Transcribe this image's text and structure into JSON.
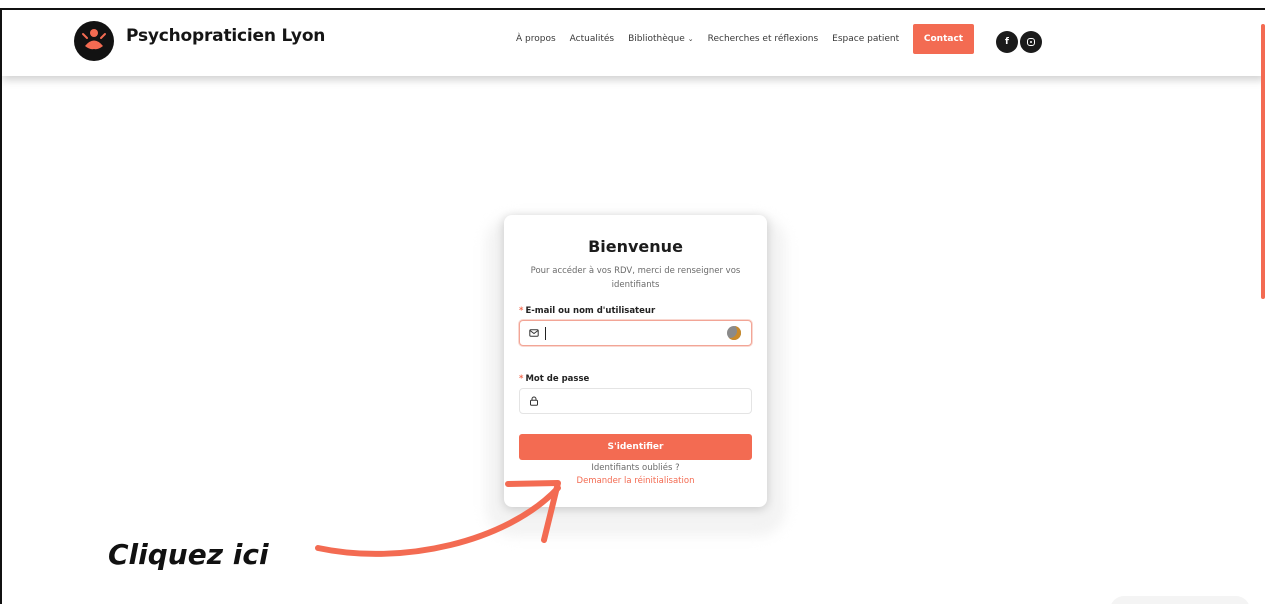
{
  "brand": {
    "name": "Psychopraticien Lyon",
    "logo_icon": "meditation-figure-icon"
  },
  "nav": {
    "items": [
      "À propos",
      "Actualités",
      "Bibliothèque",
      "Recherches et réflexions",
      "Espace patient"
    ],
    "contact_label": "Contact",
    "social": [
      {
        "icon": "facebook-icon",
        "glyph": "f"
      },
      {
        "icon": "instagram-icon"
      }
    ]
  },
  "login": {
    "title": "Bienvenue",
    "subtitle": "Pour accéder à vos RDV, merci de renseigner vos identifiants",
    "email_label": "E-mail ou nom d'utilisateur",
    "email_value": "",
    "password_label": "Mot de passe",
    "password_value": "",
    "required_mark": "*",
    "submit_label": "S'identifier",
    "forgot_text": "Identifiants oubliés ?",
    "reset_link": "Demander la réinitialisation"
  },
  "callout": {
    "text": "Cliquez ici"
  },
  "colors": {
    "accent": "#f36b52",
    "dark": "#1b1b1b",
    "text_muted": "#6b6b6b"
  }
}
